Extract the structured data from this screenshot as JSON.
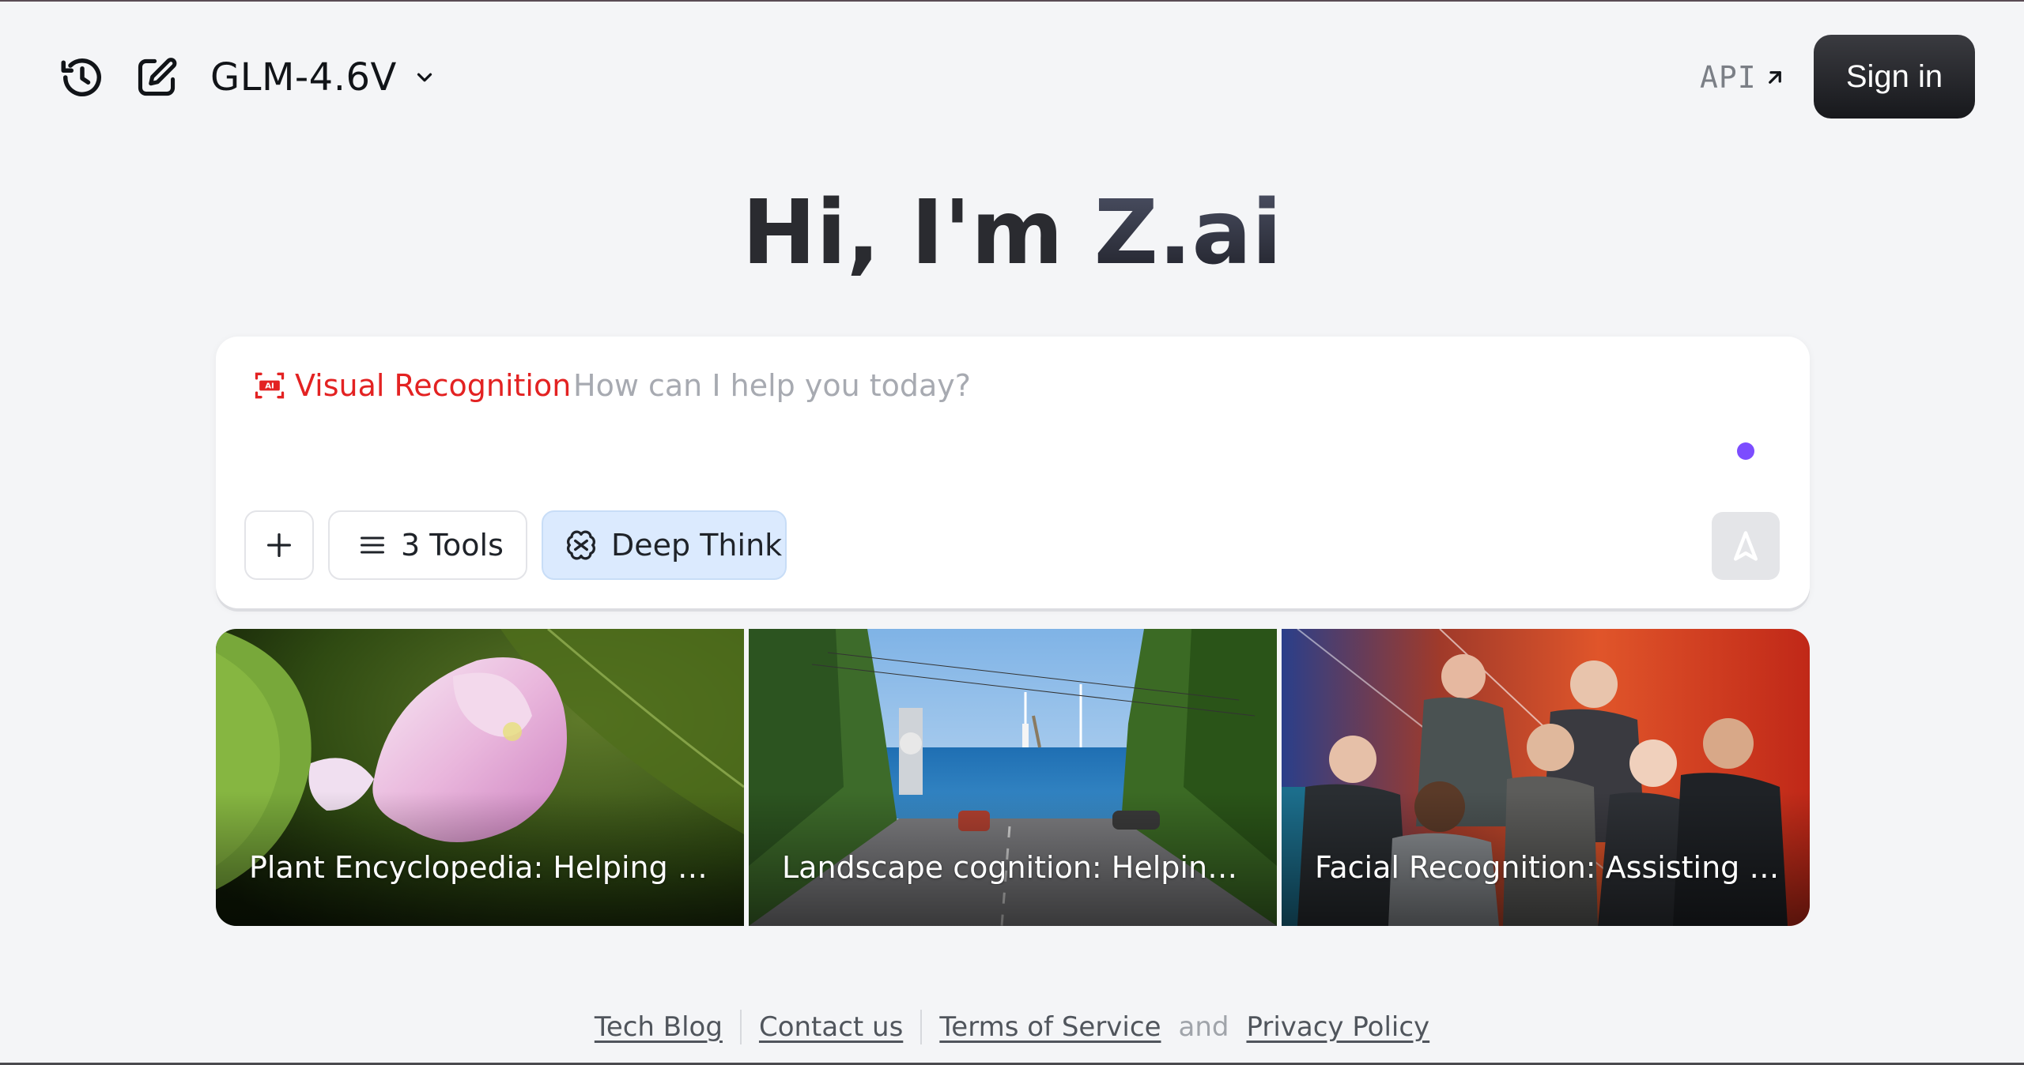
{
  "header": {
    "model_name": "GLM-4.6V",
    "api_label": "API",
    "signin_label": "Sign in"
  },
  "hero": {
    "greeting": "Hi, I'm ",
    "brand": "Z.ai"
  },
  "chat": {
    "mode_label": "Visual Recognition",
    "placeholder": "How can I help you today?",
    "tools_label": "3 Tools",
    "deep_think_label": "Deep Think"
  },
  "cards": [
    {
      "caption": "Plant Encyclopedia: Helping yo..."
    },
    {
      "caption": "Landscape cognition: Helping y..."
    },
    {
      "caption": "Facial Recognition: Assisting yo..."
    }
  ],
  "footer": {
    "tech_blog": "Tech Blog",
    "contact": "Contact us",
    "terms": "Terms of Service",
    "and": "and",
    "privacy": "Privacy Policy"
  },
  "colors": {
    "accent_red": "#e32222",
    "deep_think_bg": "#dbeafe",
    "voice_dot": "#7c4dff",
    "signin_bg": "#1f2024"
  },
  "icons": [
    "history-icon",
    "new-chat-icon",
    "chevron-down-icon",
    "arrow-up-right-icon",
    "ai-scan-icon",
    "plus-icon",
    "list-icon",
    "deep-think-icon",
    "send-icon"
  ]
}
